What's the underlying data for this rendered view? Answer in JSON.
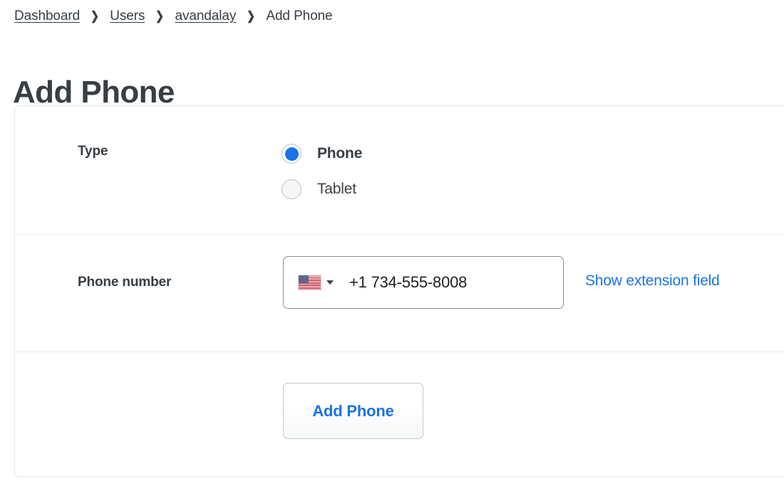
{
  "breadcrumb": {
    "items": [
      {
        "label": "Dashboard",
        "link": true
      },
      {
        "label": "Users",
        "link": true
      },
      {
        "label": "avandalay",
        "link": true
      },
      {
        "label": "Add Phone",
        "link": false
      }
    ],
    "separator": "❯"
  },
  "page": {
    "title": "Add Phone"
  },
  "form": {
    "type_field": {
      "label": "Type",
      "options": [
        {
          "label": "Phone",
          "selected": true
        },
        {
          "label": "Tablet",
          "selected": false
        }
      ]
    },
    "phone_field": {
      "label": "Phone number",
      "country_flag": "us-flag-icon",
      "dropdown_icon": "chevron-down-icon",
      "value": "+1 734-555-8008",
      "placeholder": "Phone number",
      "extension_link": "Show extension field"
    },
    "submit": {
      "label": "Add Phone"
    }
  },
  "colors": {
    "accent_blue": "#1a73e8",
    "text_dark": "#373e44",
    "border_light": "#e2e8ed",
    "input_border": "#8a8f94"
  }
}
